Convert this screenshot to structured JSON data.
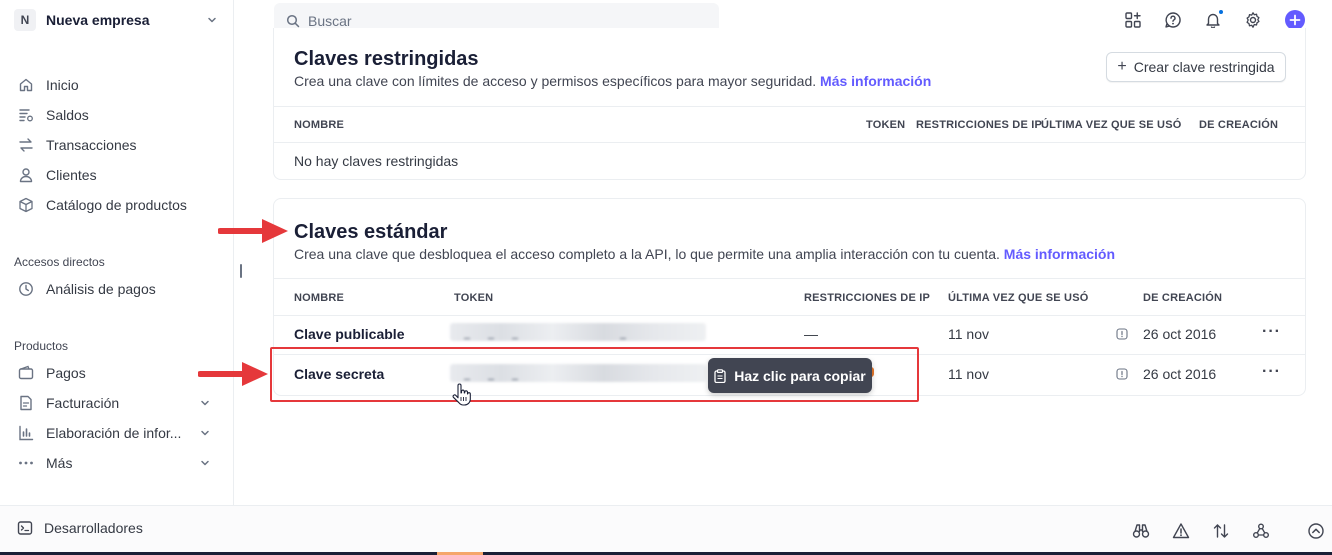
{
  "company": {
    "avatar": "N",
    "name": "Nueva empresa"
  },
  "nav": {
    "main": [
      {
        "label": "Inicio",
        "icon": "home-icon"
      },
      {
        "label": "Saldos",
        "icon": "balances-icon"
      },
      {
        "label": "Transacciones",
        "icon": "transactions-icon"
      },
      {
        "label": "Clientes",
        "icon": "customer-icon"
      },
      {
        "label": "Catálogo de productos",
        "icon": "box-icon"
      }
    ],
    "shortcuts_label": "Accesos directos",
    "shortcuts": [
      {
        "label": "Análisis de pagos",
        "icon": "clock-icon"
      }
    ],
    "products_label": "Productos",
    "products": [
      {
        "label": "Pagos",
        "icon": "wallet-icon"
      },
      {
        "label": "Facturación",
        "icon": "billing-icon"
      },
      {
        "label": "Elaboración de infor...",
        "icon": "bar-chart-icon"
      },
      {
        "label": "Más",
        "icon": "more-dots-icon"
      }
    ]
  },
  "search": {
    "placeholder": "Buscar"
  },
  "restricted": {
    "title": "Claves restringidas",
    "desc": "Crea una clave con límites de acceso y permisos específicos para mayor seguridad.",
    "link": "Más información",
    "create_button": "Crear clave restringida",
    "columns": [
      "NOMBRE",
      "TOKEN",
      "RESTRICCIONES DE IP",
      "ÚLTIMA VEZ QUE SE USÓ",
      "DE CREACIÓN"
    ],
    "empty": "No hay claves restringidas"
  },
  "standard": {
    "title": "Claves estándar",
    "desc": "Crea una clave que desbloquea el acceso completo a la API, lo que permite una amplia interacción con tu cuenta.",
    "link": "Más información",
    "columns": [
      "NOMBRE",
      "TOKEN",
      "RESTRICCIONES DE IP",
      "ÚLTIMA VEZ QUE SE USÓ",
      "DE CREACIÓN"
    ],
    "rows": [
      {
        "name": "Clave publicable",
        "ip": "—",
        "last_used": "11 nov",
        "created": "26 oct 2016",
        "more": "···"
      },
      {
        "name": "Clave secreta",
        "ip": "",
        "last_used": "11 nov",
        "created": "26 oct 2016",
        "more": "···"
      }
    ],
    "tooltip": "Haz clic para copiar"
  },
  "bottom": {
    "developers": "Desarrolladores"
  },
  "colors": {
    "accent": "#635bff",
    "annotation": "#e5383b"
  }
}
